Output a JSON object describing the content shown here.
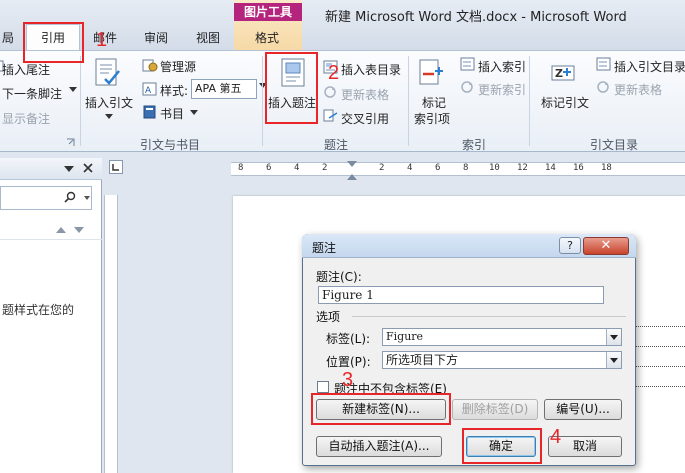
{
  "window": {
    "title": "新建 Microsoft Word 文档.docx - Microsoft Word",
    "contextual_tab_group": "图片工具"
  },
  "tabs": [
    {
      "label": "局"
    },
    {
      "label": "引用"
    },
    {
      "label": "邮件"
    },
    {
      "label": "审阅"
    },
    {
      "label": "视图"
    },
    {
      "label": "格式"
    }
  ],
  "ribbon": {
    "footnotes": {
      "insert_endnote": "插入尾注",
      "next_footnote": "下一条脚注",
      "show_notes": "显示备注"
    },
    "citations": {
      "insert_citation": "插入引文",
      "manage_sources": "管理源",
      "style_label": "样式:",
      "style_value": "APA 第五",
      "bibliography": "书目",
      "group_label": "引文与书目"
    },
    "captions": {
      "insert_caption": "插入题注",
      "insert_table_of_figures": "插入表目录",
      "update_table": "更新表格",
      "cross_reference": "交叉引用",
      "group_label": "题注"
    },
    "index": {
      "mark_entry": "标记",
      "mark_entry_2": "索引项",
      "insert_index": "插入索引",
      "update_index": "更新索引",
      "group_label": "索引"
    },
    "table_of_authorities": {
      "mark_citation": "标记引文",
      "insert_toa": "插入引文目录",
      "update_table": "更新表格",
      "group_label": "引文目录"
    }
  },
  "nav_pane": {
    "snippet": "题样式在您的"
  },
  "ruler": {
    "numbers": [
      "8",
      "6",
      "4",
      "2",
      "2",
      "4",
      "6",
      "8",
      "10",
      "12",
      "14",
      "16",
      "18"
    ]
  },
  "dialog": {
    "title": "题注",
    "help": "?",
    "close": "✕",
    "caption_label": "题注(C):",
    "caption_value": "Figure 1",
    "options_label": "选项",
    "label_label": "标签(L):",
    "label_value": "Figure",
    "position_label": "位置(P):",
    "position_value": "所选项目下方",
    "exclude_label": "题注中不包含标签(E)",
    "new_label_button": "新建标签(N)...",
    "delete_label_button": "删除标签(D)",
    "numbering_button": "编号(U)...",
    "autocaption_button": "自动插入题注(A)...",
    "ok_button": "确定",
    "cancel_button": "取消"
  },
  "annotations": {
    "step1": "1",
    "step2": "2",
    "step3": "3",
    "step4": "4"
  },
  "colors": {
    "annotation_red": "#e8262a",
    "contextual_tab_magenta": "#b4247d"
  }
}
